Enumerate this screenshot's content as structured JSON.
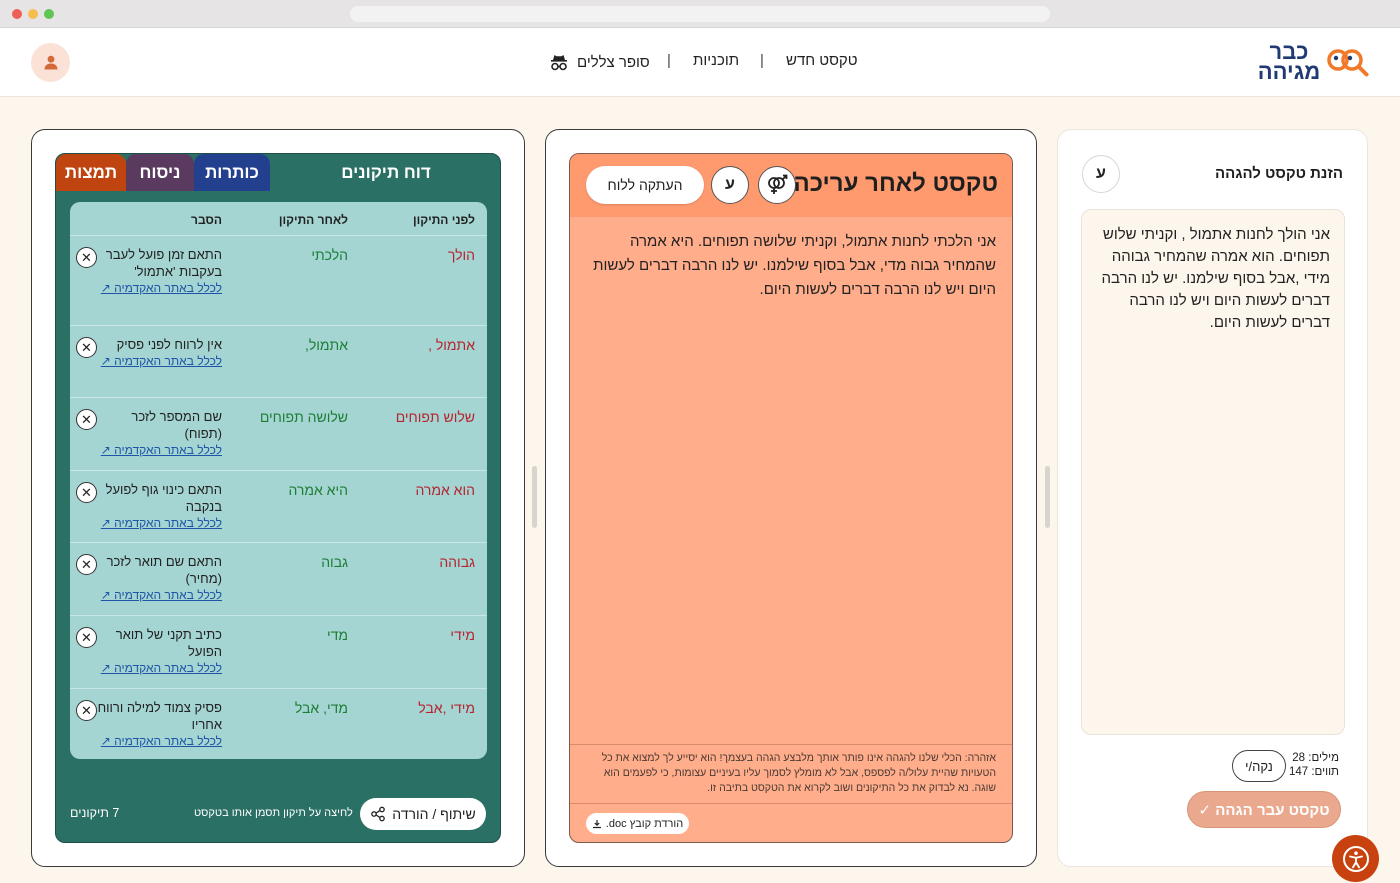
{
  "header": {
    "logo_line1": "כבר",
    "logo_line2": "מגיהה",
    "nav": {
      "new_text": "טקסט חדש",
      "plans": "תוכניות",
      "ghostwriter": "סופר צללים"
    },
    "separator": "|"
  },
  "input_panel": {
    "title": "הזנת טקסט להגהה",
    "lang_button": "ע",
    "text": "אני הולך לחנות אתמול , וקניתי שלוש תפוחים. הוא אמרה שהמחיר גבוהה מידי ,אבל בסוף שילמנו. יש לנו הרבה דברים לעשות היום ויש לנו הרבה דברים לעשות היום.",
    "words_label": "מילים:",
    "words_count": "28",
    "chars_label": "תווים:",
    "chars_count": "147",
    "clear_button": "נקה/י",
    "submit_button": "טקסט עבר הגהה ✓"
  },
  "edited_panel": {
    "title": "טקסט לאחר עריכה",
    "lang_button": "ע",
    "gender_icon": "gender-icon",
    "copy_button": "העתקה ללוח",
    "text": "אני הלכתי לחנות אתמול, וקניתי שלושה תפוחים. היא אמרה שהמחיר גבוה מדי, אבל בסוף שילמנו. יש לנו הרבה דברים לעשות היום ויש לנו הרבה דברים לעשות היום.",
    "warning": "אזהרה: הכלי שלנו להגהה אינו פותר אותך מלבצע הגהה בעצמך! הוא יסייע לך למצוא את כל הטעויות שהיית עלול/ה לפספס, אבל לא מומלץ לסמוך עליו בעיניים עצומות, כי לפעמים הוא שוגה. נא לבדוק את כל התיקונים ושוב לקרוא את הטקסט בתיבה זו.",
    "download_button": "הורדת קובץ doc."
  },
  "report_panel": {
    "title": "דוח תיקונים",
    "tabs": [
      "כותרות",
      "ניסוח",
      "תמצות"
    ],
    "tab_colors": [
      "#23408f",
      "#5b3a5f",
      "#c0440f"
    ],
    "columns": {
      "before": "לפני התיקון",
      "after": "לאחר התיקון",
      "explanation": "הסבר"
    },
    "link_text": "לכלל באתר האקדמיה ↗",
    "rows": [
      {
        "before": "הולך",
        "after": "הלכתי",
        "explanation": "התאם זמן פועל לעבר בעקבות 'אתמול'"
      },
      {
        "before": "אתמול ,",
        "after": "אתמול,",
        "explanation": "אין לרווח לפני פסיק"
      },
      {
        "before": "שלוש תפוחים",
        "after": "שלושה תפוחים",
        "explanation": "שם המספר לזכר (תפוח)"
      },
      {
        "before": "הוא אמרה",
        "after": "היא אמרה",
        "explanation": "התאם כינוי גוף לפועל בנקבה"
      },
      {
        "before": "גבוהה",
        "after": "גבוה",
        "explanation": "התאם שם תואר לזכר (מחיר)"
      },
      {
        "before": "מידי",
        "after": "מדי",
        "explanation": "כתיב תקני של תואר הפועל"
      },
      {
        "before": "מידי ,אבל",
        "after": "מדי, אבל",
        "explanation": "פסיק צמוד למילה ורווח אחריו"
      }
    ],
    "share_button": "שיתוף / הורדה",
    "hint": "לחיצה על תיקון תסמן אותו בטקסט",
    "count": "7 תיקונים"
  },
  "accessibility_icon": "accessibility-icon"
}
